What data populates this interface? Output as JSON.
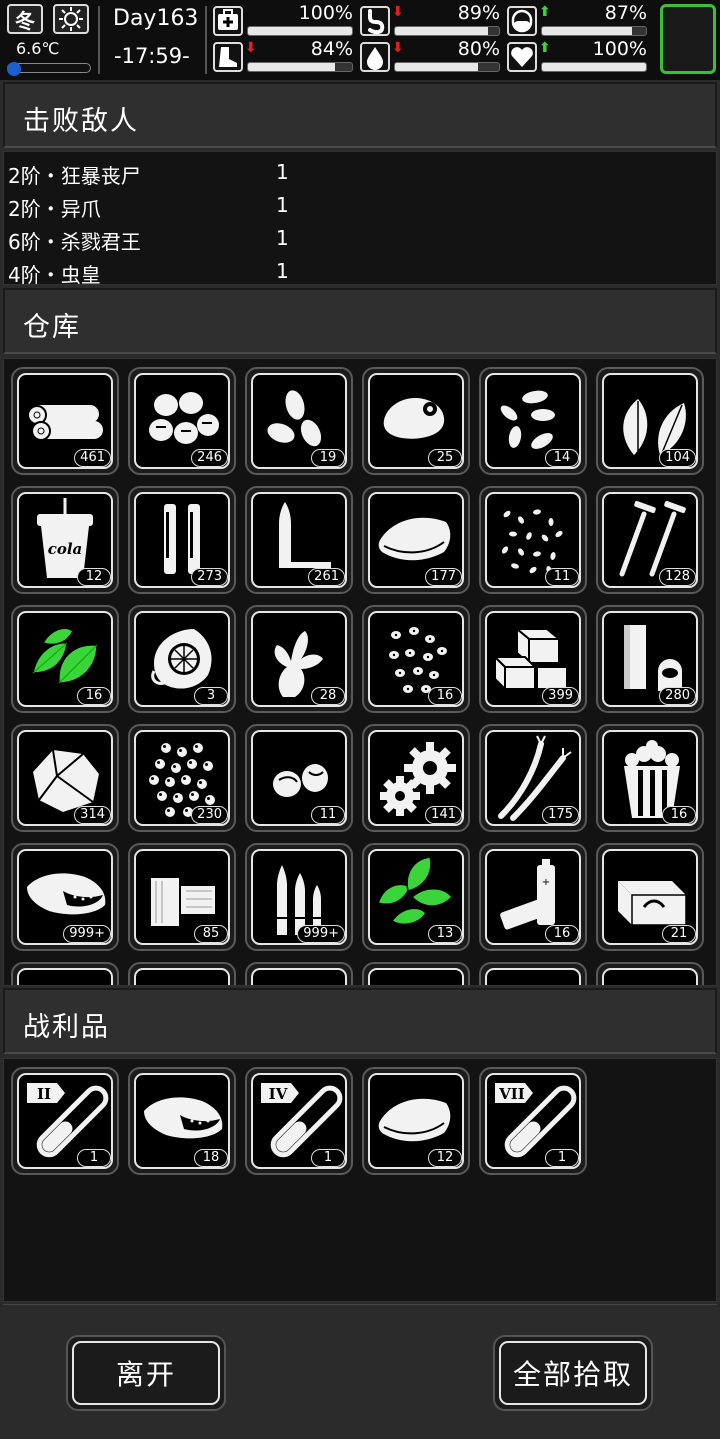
{
  "status": {
    "season": "冬",
    "temperature": "6.6℃",
    "temperature_level": 0.1,
    "day": "Day163",
    "clock": "-17:59-",
    "stats": [
      {
        "name": "health",
        "icon": "medkit-icon",
        "value": "100%",
        "level": 1.0,
        "arrow": ""
      },
      {
        "name": "hunger",
        "icon": "stomach-icon",
        "value": "89%",
        "level": 0.89,
        "arrow": "down"
      },
      {
        "name": "medicine",
        "icon": "pill-icon",
        "value": "87%",
        "level": 0.87,
        "arrow": "up"
      },
      {
        "name": "stamina",
        "icon": "boot-icon",
        "value": "84%",
        "level": 0.84,
        "arrow": "down"
      },
      {
        "name": "thirst",
        "icon": "water-drop-icon",
        "value": "80%",
        "level": 0.8,
        "arrow": "down"
      },
      {
        "name": "mood",
        "icon": "heart-icon",
        "value": "100%",
        "level": 1.0,
        "arrow": "up"
      }
    ]
  },
  "sections": {
    "enemies_title": "击败敌人",
    "storage_title": "仓库",
    "loot_title": "战利品"
  },
  "enemies": [
    {
      "name": "2阶・狂暴丧尸",
      "count": "1"
    },
    {
      "name": "2阶・异爪",
      "count": "1"
    },
    {
      "name": "6阶・杀戮君王",
      "count": "1"
    },
    {
      "name": "4阶・虫皇",
      "count": "1"
    }
  ],
  "storage_items": [
    {
      "icon": "wood-logs-icon",
      "qty": "461"
    },
    {
      "icon": "eggs-icon",
      "qty": "246"
    },
    {
      "icon": "almonds-icon",
      "qty": "19"
    },
    {
      "icon": "raw-chicken-icon",
      "qty": "25"
    },
    {
      "icon": "seeds-icon",
      "qty": "14"
    },
    {
      "icon": "leaves-icon",
      "qty": "104"
    },
    {
      "icon": "cola-cup-icon",
      "qty": "12",
      "label": "cola"
    },
    {
      "icon": "shell-casings-icon",
      "qty": "273"
    },
    {
      "icon": "bullets-icon",
      "qty": "261"
    },
    {
      "icon": "cloth-icon",
      "qty": "177"
    },
    {
      "icon": "grain-icon",
      "qty": "11"
    },
    {
      "icon": "nails-icon",
      "qty": "128"
    },
    {
      "icon": "herb-green-icon",
      "qty": "16"
    },
    {
      "icon": "lemon-net-icon",
      "qty": "3"
    },
    {
      "icon": "ginger-icon",
      "qty": "28"
    },
    {
      "icon": "beans-icon",
      "qty": "16"
    },
    {
      "icon": "bricks-icon",
      "qty": "399"
    },
    {
      "icon": "tubes-icon",
      "qty": "280"
    },
    {
      "icon": "crumpled-paper-icon",
      "qty": "314"
    },
    {
      "icon": "pellets-icon",
      "qty": "230"
    },
    {
      "icon": "nuts-icon",
      "qty": "11"
    },
    {
      "icon": "gears-icon",
      "qty": "141"
    },
    {
      "icon": "wires-icon",
      "qty": "175"
    },
    {
      "icon": "popcorn-icon",
      "qty": "16"
    },
    {
      "icon": "meat-icon",
      "qty": "999+"
    },
    {
      "icon": "planks-icon",
      "qty": "85"
    },
    {
      "icon": "rifle-ammo-icon",
      "qty": "999+"
    },
    {
      "icon": "mint-icon",
      "qty": "13"
    },
    {
      "icon": "batteries-icon",
      "qty": "16"
    },
    {
      "icon": "toolbox-icon",
      "qty": "21"
    }
  ],
  "loot_items": [
    {
      "icon": "test-tube-icon",
      "tier": "II",
      "qty": "1"
    },
    {
      "icon": "meat-icon",
      "qty": "18"
    },
    {
      "icon": "test-tube-icon",
      "tier": "IV",
      "qty": "1"
    },
    {
      "icon": "cloth-icon",
      "qty": "12"
    },
    {
      "icon": "test-tube-icon",
      "tier": "VII",
      "qty": "1"
    }
  ],
  "buttons": {
    "leave": "离开",
    "take_all": "全部拾取"
  },
  "colors": {
    "accent_green": "#3bbf3b",
    "arrow_up": "#3bd43b",
    "arrow_down": "#e02020",
    "temp_blue": "#1b5fd1"
  }
}
